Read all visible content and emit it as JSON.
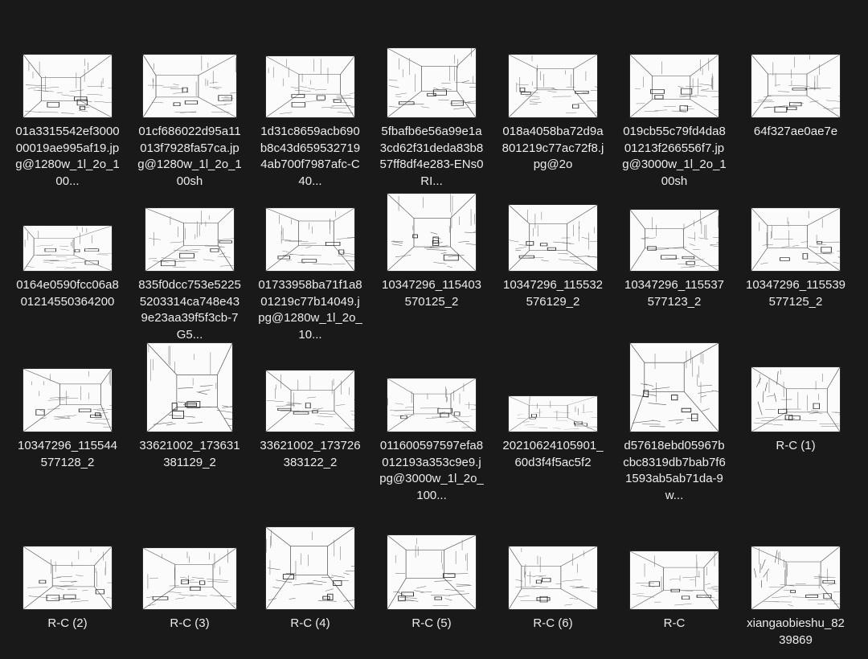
{
  "files": [
    {
      "name": "01a3315542ef300000019ae995af19.jpg@1280w_1l_2o_100...",
      "thumb_icon": "interior-sketch-thumbnail"
    },
    {
      "name": "01cf686022d95a11013f7928fa57ca.jpg@1280w_1l_2o_100sh",
      "thumb_icon": "interior-sketch-thumbnail"
    },
    {
      "name": "1d31c8659acb690b8c43d6595327194ab700f7987afc-C40...",
      "thumb_icon": "interior-sketch-thumbnail"
    },
    {
      "name": "5fbafb6e56a99e1a3cd62f31deda83b857ff8df4e283-ENs0RI...",
      "thumb_icon": "interior-sketch-thumbnail"
    },
    {
      "name": "018a4058ba72d9a801219c77ac72f8.jpg@2o",
      "thumb_icon": "interior-sketch-thumbnail"
    },
    {
      "name": "019cb55c79fd4da801213f266556f7.jpg@3000w_1l_2o_100sh",
      "thumb_icon": "interior-sketch-thumbnail"
    },
    {
      "name": "64f327ae0ae7e",
      "thumb_icon": "interior-sketch-thumbnail"
    },
    {
      "name": "0164e0590fcc06a801214550364200",
      "thumb_icon": "interior-sketch-thumbnail"
    },
    {
      "name": "835f0dcc753e52255203314ca748e439e23aa39f5f3cb-7G5...",
      "thumb_icon": "interior-sketch-thumbnail"
    },
    {
      "name": "01733958ba71f1a801219c77b14049.jpg@1280w_1l_2o_10...",
      "thumb_icon": "interior-sketch-thumbnail"
    },
    {
      "name": "10347296_115403570125_2",
      "thumb_icon": "interior-sketch-thumbnail"
    },
    {
      "name": "10347296_115532576129_2",
      "thumb_icon": "interior-sketch-thumbnail"
    },
    {
      "name": "10347296_115537577123_2",
      "thumb_icon": "interior-sketch-thumbnail"
    },
    {
      "name": "10347296_115539577125_2",
      "thumb_icon": "interior-sketch-thumbnail"
    },
    {
      "name": "10347296_115544577128_2",
      "thumb_icon": "interior-sketch-thumbnail"
    },
    {
      "name": "33621002_173631381129_2",
      "thumb_icon": "interior-sketch-thumbnail"
    },
    {
      "name": "33621002_173726383122_2",
      "thumb_icon": "interior-sketch-thumbnail"
    },
    {
      "name": "011600597597efa8012193a353c9e9.jpg@3000w_1l_2o_100...",
      "thumb_icon": "interior-sketch-thumbnail"
    },
    {
      "name": "20210624105901_60d3f4f5ac5f2",
      "thumb_icon": "interior-sketch-thumbnail"
    },
    {
      "name": "d57618ebd05967bcbc8319db7bab7f61593ab5ab71da-9w...",
      "thumb_icon": "interior-sketch-thumbnail"
    },
    {
      "name": "R-C (1)",
      "thumb_icon": "exterior-sketch-thumbnail"
    },
    {
      "name": "R-C (2)",
      "thumb_icon": "interior-sketch-thumbnail"
    },
    {
      "name": "R-C (3)",
      "thumb_icon": "interior-sketch-thumbnail"
    },
    {
      "name": "R-C (4)",
      "thumb_icon": "interior-sketch-thumbnail"
    },
    {
      "name": "R-C (5)",
      "thumb_icon": "interior-sketch-thumbnail"
    },
    {
      "name": "R-C (6)",
      "thumb_icon": "interior-sketch-thumbnail"
    },
    {
      "name": "R-C",
      "thumb_icon": "interior-sketch-thumbnail"
    },
    {
      "name": "xiangaobieshu_8239869",
      "thumb_icon": "exterior-sketch-thumbnail"
    }
  ],
  "colors": {
    "background": "#191919",
    "text": "#ececec",
    "thumb_paper": "#fbfbfb"
  }
}
